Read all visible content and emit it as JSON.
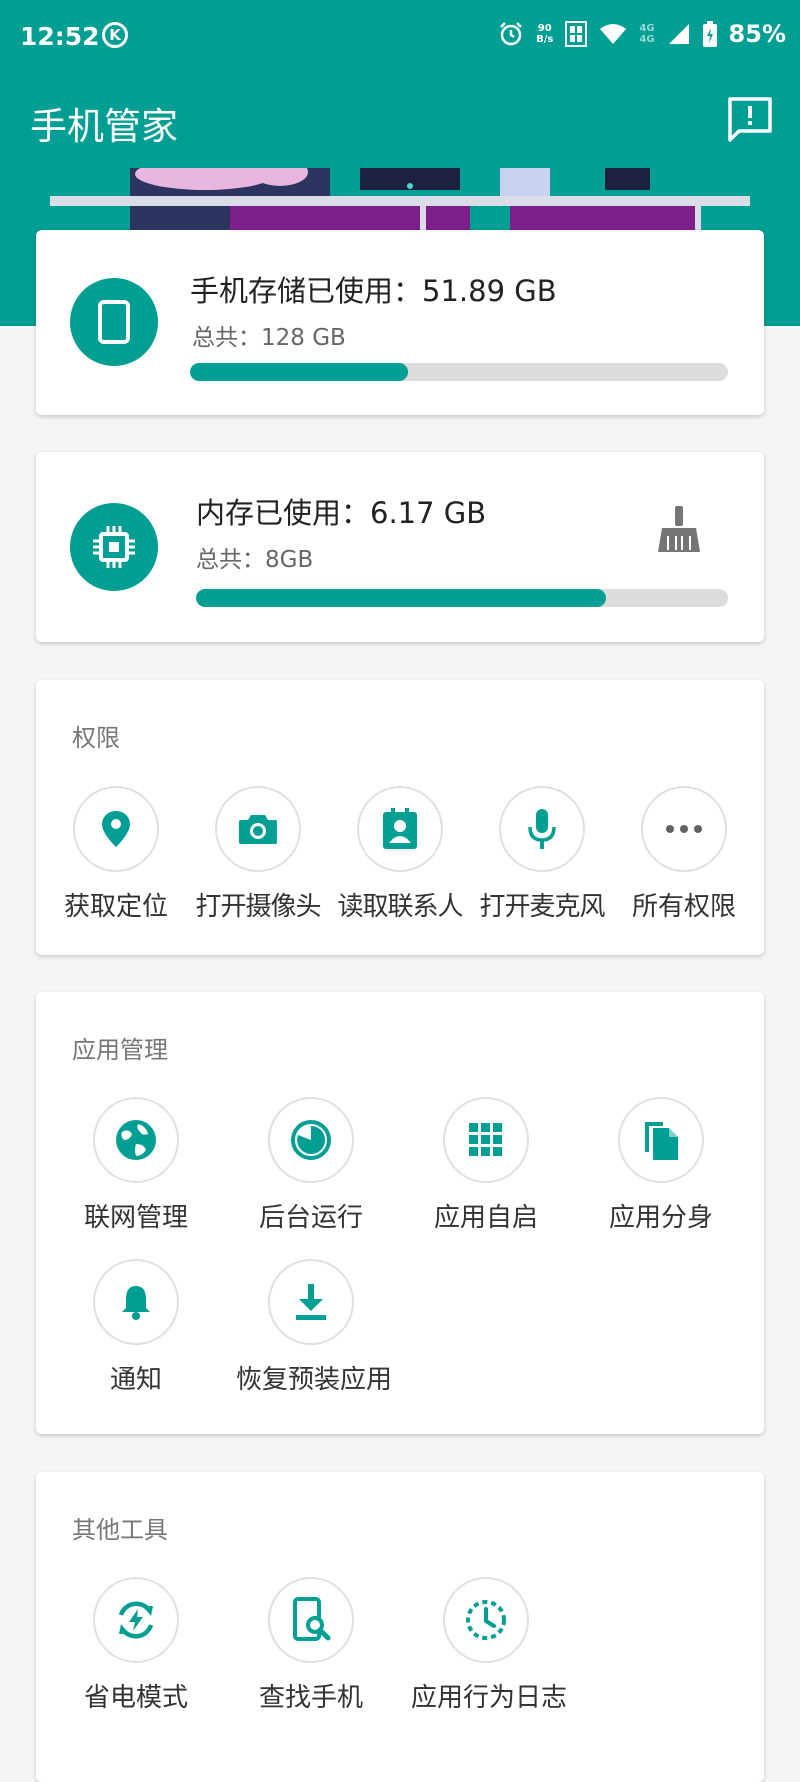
{
  "status_bar": {
    "time": "12:52",
    "k_badge": "K",
    "speed_value": "90",
    "speed_unit": "B/s",
    "network": "4G",
    "battery_percent": "85%"
  },
  "header": {
    "title": "手机管家",
    "feedback_icon": "feedback-icon"
  },
  "storage": {
    "used_label": "手机存储已使用：51.89 GB",
    "total_label": "总共：128 GB",
    "used_fraction": 0.405,
    "icon": "phone-icon"
  },
  "memory": {
    "used_label": "内存已使用：6.17 GB",
    "total_label": "总共：8GB",
    "used_fraction": 0.771,
    "icon": "chip-icon",
    "clean_icon": "broom-icon"
  },
  "permissions": {
    "title": "权限",
    "items": [
      {
        "label": "获取定位",
        "icon": "location-icon"
      },
      {
        "label": "打开摄像头",
        "icon": "camera-icon"
      },
      {
        "label": "读取联系人",
        "icon": "contacts-icon"
      },
      {
        "label": "打开麦克风",
        "icon": "microphone-icon"
      },
      {
        "label": "所有权限",
        "icon": "more-icon"
      }
    ]
  },
  "app_management": {
    "title": "应用管理",
    "items": [
      {
        "label": "联网管理",
        "icon": "globe-icon"
      },
      {
        "label": "后台运行",
        "icon": "pie-icon"
      },
      {
        "label": "应用自启",
        "icon": "grid-icon"
      },
      {
        "label": "应用分身",
        "icon": "copy-icon"
      },
      {
        "label": "通知",
        "icon": "bell-icon"
      },
      {
        "label": "恢复预装应用",
        "icon": "download-icon"
      }
    ]
  },
  "other_tools": {
    "title": "其他工具",
    "items": [
      {
        "label": "省电模式",
        "icon": "battery-saver-icon"
      },
      {
        "label": "查找手机",
        "icon": "find-phone-icon"
      },
      {
        "label": "应用行为日志",
        "icon": "activity-log-icon"
      }
    ]
  },
  "colors": {
    "accent": "#009e93",
    "background": "#f5f5f5",
    "card": "#ffffff",
    "track": "#dcdcdc"
  }
}
